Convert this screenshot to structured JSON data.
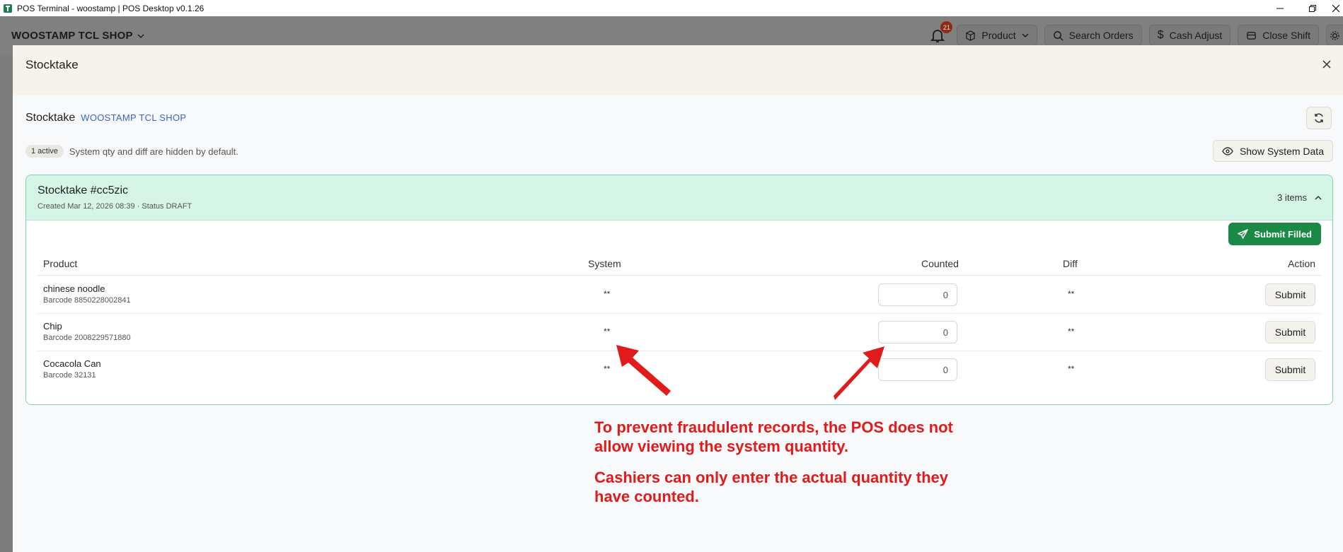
{
  "window": {
    "title": "POS Terminal - woostamp | POS Desktop v0.1.26"
  },
  "header": {
    "shop_name": "WOOSTAMP TCL SHOP",
    "notification_count": "21",
    "buttons": {
      "product": "Product",
      "search_orders": "Search Orders",
      "cash_adjust": "Cash Adjust",
      "close_shift": "Close Shift"
    }
  },
  "modal": {
    "title": "Stocktake",
    "sub_label": "Stocktake",
    "shop": "WOOSTAMP TCL SHOP",
    "active_badge": "1 active",
    "info_text": "System qty and diff are hidden by default.",
    "show_system_label": "Show System Data"
  },
  "stocktake": {
    "title": "Stocktake #cc5zic",
    "subtitle": "Created Mar 12, 2026 08:39 · Status DRAFT",
    "items_count": "3 items",
    "submit_filled_label": "Submit Filled",
    "columns": {
      "product": "Product",
      "system": "System",
      "counted": "Counted",
      "diff": "Diff",
      "action": "Action"
    },
    "rows": [
      {
        "name": "chinese noodle",
        "barcode": "Barcode 8850228002841",
        "system": "**",
        "counted": "0",
        "diff": "**",
        "action": "Submit"
      },
      {
        "name": "Chip",
        "barcode": "Barcode 2008229571880",
        "system": "**",
        "counted": "0",
        "diff": "**",
        "action": "Submit"
      },
      {
        "name": "Cocacola Can",
        "barcode": "Barcode 32131",
        "system": "**",
        "counted": "0",
        "diff": "**",
        "action": "Submit"
      }
    ]
  },
  "annotation": {
    "line1": "To prevent fraudulent records, the POS does not",
    "line2": "allow viewing the system quantity.",
    "line3": "Cashiers can only enter the actual quantity they",
    "line4": "have counted."
  },
  "colors": {
    "accent_green": "#1b8a47",
    "card_header": "#d5f6e6",
    "link_blue": "#3d63c9",
    "annotation_red": "#e11b1b"
  }
}
